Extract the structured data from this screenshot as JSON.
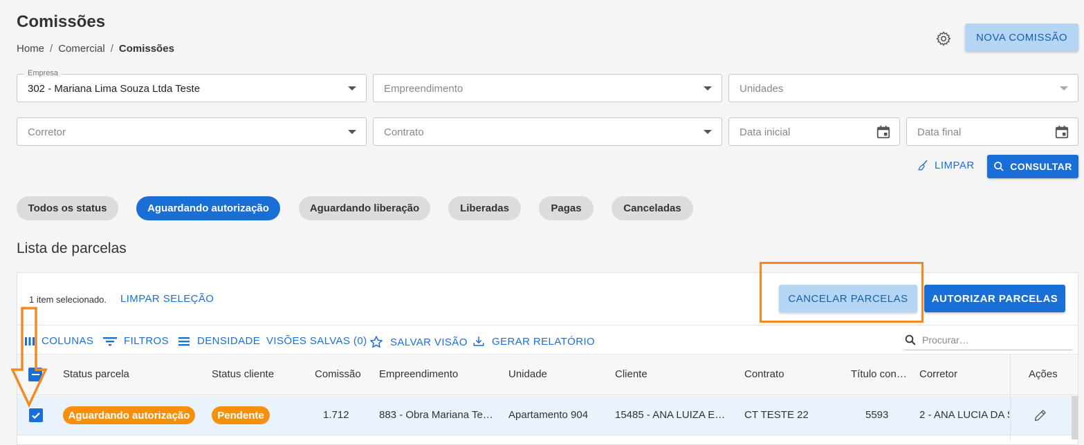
{
  "page": {
    "title": "Comissões",
    "breadcrumb": [
      "Home",
      "Comercial",
      "Comissões"
    ],
    "nova_comissao": "NOVA COMISSÃO"
  },
  "filters": {
    "empresa_label": "Empresa",
    "empresa_value": "302 - Mariana  Lima Souza Ltda Teste",
    "empreendimento_placeholder": "Empreendimento",
    "unidades_placeholder": "Unidades",
    "corretor_placeholder": "Corretor",
    "contrato_placeholder": "Contrato",
    "data_inicial_placeholder": "Data inicial",
    "data_final_placeholder": "Data final",
    "limpar": "LIMPAR",
    "consultar": "CONSULTAR"
  },
  "status_chips": [
    {
      "label": "Todos os status",
      "active": false
    },
    {
      "label": "Aguardando autorização",
      "active": true
    },
    {
      "label": "Aguardando liberação",
      "active": false
    },
    {
      "label": "Liberadas",
      "active": false
    },
    {
      "label": "Pagas",
      "active": false
    },
    {
      "label": "Canceladas",
      "active": false
    }
  ],
  "list": {
    "title": "Lista de parcelas",
    "selection_text": "1 item selecionado.",
    "clear_selection": "LIMPAR SELEÇÃO",
    "cancel_button": "CANCELAR PARCELAS",
    "authorize_button": "AUTORIZAR PARCELAS"
  },
  "toolbar": {
    "colunas": "COLUNAS",
    "filtros": "FILTROS",
    "densidade": "DENSIDADE",
    "visoes_salvas": "VISÕES SALVAS (0)",
    "salvar_visao": "SALVAR VISÃO",
    "gerar_relatorio": "GERAR RELATÓRIO",
    "search_placeholder": "Procurar…"
  },
  "table": {
    "headers": [
      "Status parcela",
      "Status cliente",
      "Comissão",
      "Empreendimento",
      "Unidade",
      "Cliente",
      "Contrato",
      "Título con…",
      "Corretor",
      "Ações"
    ],
    "rows": [
      {
        "status_parcela": "Aguardando autorização",
        "status_cliente": "Pendente",
        "comissao": "1.712",
        "empreendimento": "883 - Obra Mariana Te…",
        "unidade": "Apartamento 904",
        "cliente": "15485 - ANA LUIZA E…",
        "contrato": "CT TESTE 22",
        "titulo": "5593",
        "corretor": "2 - ANA LUCIA DA S"
      }
    ]
  },
  "colors": {
    "primary": "#1a6fd6",
    "light_primary": "#b5d5f5",
    "badge_orange": "#f5900d",
    "annotation_orange": "#f08a24"
  }
}
